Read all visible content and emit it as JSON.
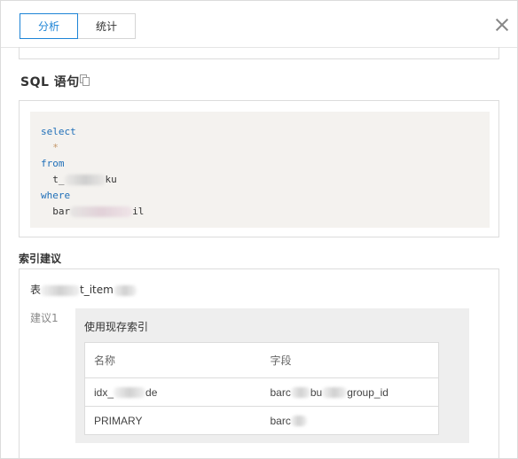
{
  "tabs": [
    {
      "label": "分析",
      "active": true
    },
    {
      "label": "统计",
      "active": false
    }
  ],
  "sql": {
    "title": "SQL 语句",
    "lines": {
      "select": "select",
      "star": "  *",
      "from": "from",
      "table_prefix": "  t_",
      "table_suffix": "ku",
      "where": "where",
      "cond_prefix": "  bar",
      "cond_suffix": "il"
    }
  },
  "index": {
    "title": "索引建议",
    "table_prefix": "表",
    "table_visible": "t_item",
    "suggestion_label": "建议1",
    "suggestion_heading": "使用现存索引",
    "columns": [
      "名称",
      "字段"
    ],
    "rows": [
      {
        "name_prefix": "idx_",
        "name_suffix": "de",
        "field_prefix": "barc",
        "field_mid": "bu",
        "field_suffix": "group_id"
      },
      {
        "name": "PRIMARY",
        "field_prefix": "barc"
      }
    ]
  },
  "colors": {
    "accent": "#1d84d6",
    "keyword": "#1f6fb8",
    "code_bg": "#f4f2ef"
  },
  "icons": {
    "close": "close-icon",
    "copy": "copy-icon"
  }
}
